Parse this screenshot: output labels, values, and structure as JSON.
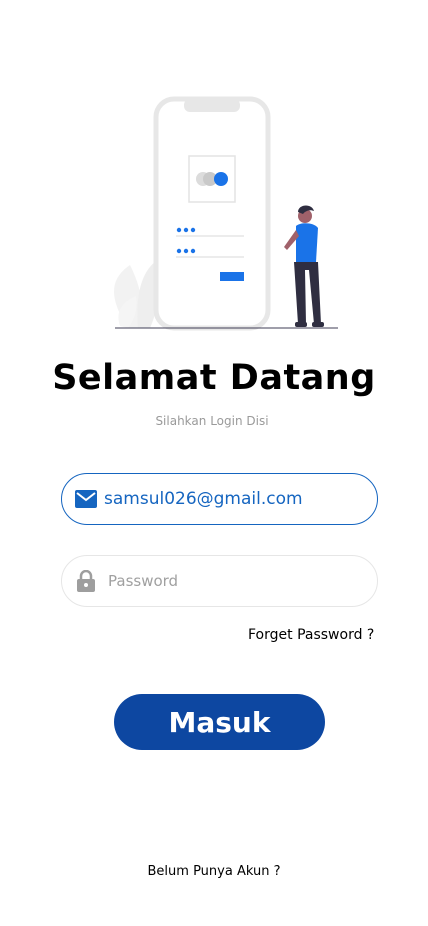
{
  "header": {
    "title": "Selamat Datang",
    "subtitle": "Silahkan Login Disi"
  },
  "login": {
    "email_value": "samsul026@gmail.com",
    "password_placeholder": "Password",
    "forget_label": "Forget Password ?",
    "submit_label": "Masuk",
    "register_label": "Belum Punya Akun ?"
  },
  "icons": {
    "email": "mail-icon",
    "password": "lock-icon",
    "illustration": "phone-login-illustration"
  },
  "colors": {
    "primary": "#0d47a1",
    "accent": "#1565c0",
    "illustration_blue": "#1a73e8"
  }
}
